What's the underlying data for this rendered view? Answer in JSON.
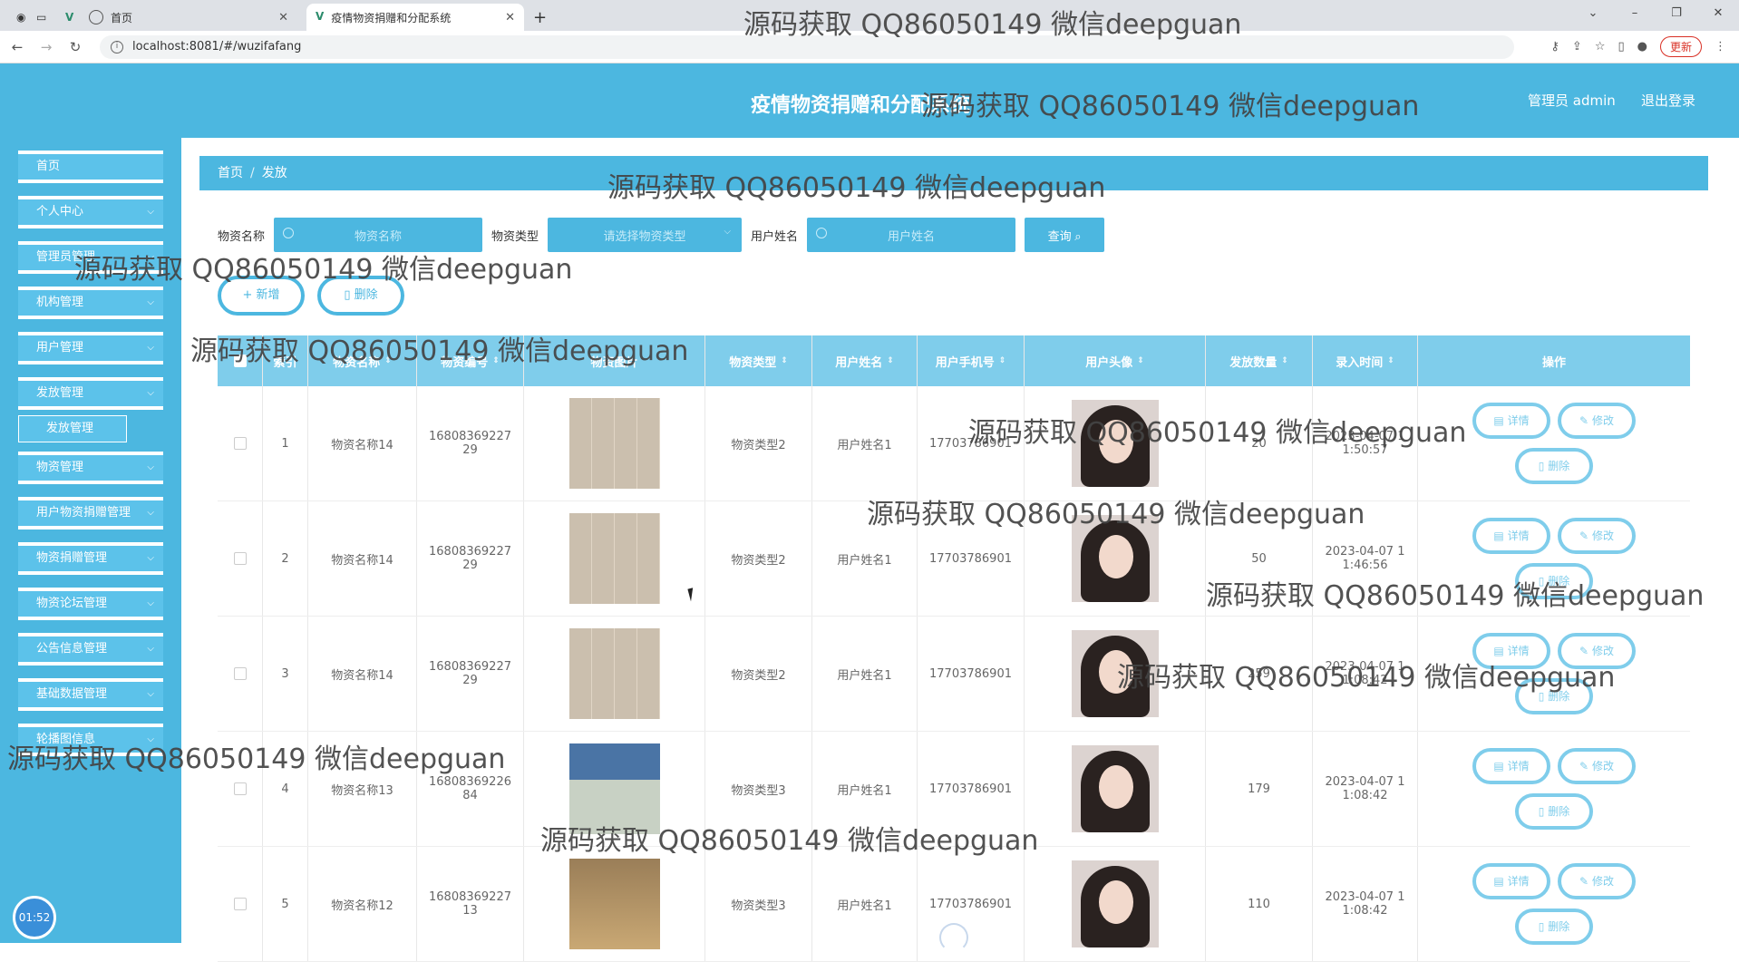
{
  "browser": {
    "tabs": [
      {
        "label": "首页",
        "active": false
      },
      {
        "label": "疫情物资捐赠和分配系统",
        "active": true
      }
    ],
    "new_tab": "+",
    "url": "localhost:8081/#/wuzifafang",
    "update_label": "更新"
  },
  "header": {
    "title": "疫情物资捐赠和分配系统",
    "user": "管理员 admin",
    "logout": "退出登录"
  },
  "sidebar": {
    "items": [
      {
        "label": "首页"
      },
      {
        "label": "个人中心"
      },
      {
        "label": "管理员管理"
      },
      {
        "label": "机构管理"
      },
      {
        "label": "用户管理"
      },
      {
        "label": "发放管理"
      },
      {
        "label": "发放管理"
      },
      {
        "label": "物资管理"
      },
      {
        "label": "用户物资捐赠管理"
      },
      {
        "label": "物资捐赠管理"
      },
      {
        "label": "物资论坛管理"
      },
      {
        "label": "公告信息管理"
      },
      {
        "label": "基础数据管理"
      },
      {
        "label": "轮播图信息"
      }
    ],
    "clock": "01:52"
  },
  "breadcrumb": {
    "home": "首页",
    "sep": "/",
    "current": "发放"
  },
  "search": {
    "name_label": "物资名称",
    "name_placeholder": "物资名称",
    "type_label": "物资类型",
    "type_placeholder": "请选择物资类型",
    "user_label": "用户姓名",
    "user_placeholder": "用户姓名",
    "query_label": "查询"
  },
  "actions": {
    "add": "+ 新增",
    "delete": "删除"
  },
  "table": {
    "headers": [
      "索引",
      "物资名称",
      "物资编号",
      "物资图片",
      "物资类型",
      "用户姓名",
      "用户手机号",
      "用户头像",
      "发放数量",
      "录入时间",
      "操作"
    ],
    "rows": [
      {
        "idx": "1",
        "name": "物资名称14",
        "code1": "16808369227",
        "code2": "29",
        "type": "物资类型2",
        "user": "用户姓名1",
        "phone": "17703786901",
        "qty": "20",
        "time1": "2023-04-07 1",
        "time2": "1:50:57"
      },
      {
        "idx": "2",
        "name": "物资名称14",
        "code1": "16808369227",
        "code2": "29",
        "type": "物资类型2",
        "user": "用户姓名1",
        "phone": "17703786901",
        "qty": "50",
        "time1": "2023-04-07 1",
        "time2": "1:46:56"
      },
      {
        "idx": "3",
        "name": "物资名称14",
        "code1": "16808369227",
        "code2": "29",
        "type": "物资类型2",
        "user": "用户姓名1",
        "phone": "17703786901",
        "qty": "259",
        "time1": "2023-04-07 1",
        "time2": "1:08:42"
      },
      {
        "idx": "4",
        "name": "物资名称13",
        "code1": "16808369226",
        "code2": "84",
        "type": "物资类型3",
        "user": "用户姓名1",
        "phone": "17703786901",
        "qty": "179",
        "time1": "2023-04-07 1",
        "time2": "1:08:42"
      },
      {
        "idx": "5",
        "name": "物资名称12",
        "code1": "16808369227",
        "code2": "13",
        "type": "物资类型3",
        "user": "用户姓名1",
        "phone": "17703786901",
        "qty": "110",
        "time1": "2023-04-07 1",
        "time2": "1:08:42"
      }
    ],
    "op_detail": "详情",
    "op_edit": "修改",
    "op_delete": "删除"
  },
  "watermark": "源码获取 QQ86050149 微信deepguan"
}
